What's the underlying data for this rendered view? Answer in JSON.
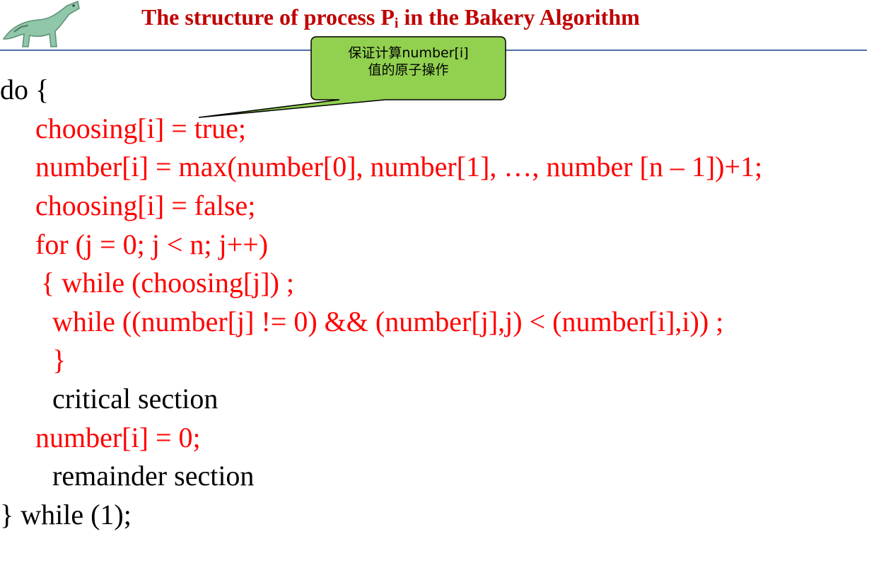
{
  "slide": {
    "title_prefix": "The structure of process P",
    "title_sub": "i",
    "title_suffix": " in the Bakery Algorithm"
  },
  "callout": {
    "line1": "保证计算number[i]",
    "line2": "值的原子操作"
  },
  "code": {
    "l1": "do {",
    "l2": "choosing[i] = true;",
    "l3": "number[i] = max(number[0], number[1], …, number [n – 1])+1;",
    "l4": "choosing[i] = false;",
    "l5": "for (j = 0; j < n; j++)",
    "l6": "{ while (choosing[j]) ;",
    "l7": "while ((number[j] != 0) && (number[j],j) < (number[i],i)) ;",
    "l8": "}",
    "l9": "critical section",
    "l10": "number[i] = 0;",
    "l11": "remainder section",
    "l12": "} while (1);"
  },
  "colors": {
    "code_red": "#ff0000",
    "title_red": "#c00000",
    "callout_fill": "#92d050",
    "rule_blue": "#4f6fa8"
  }
}
